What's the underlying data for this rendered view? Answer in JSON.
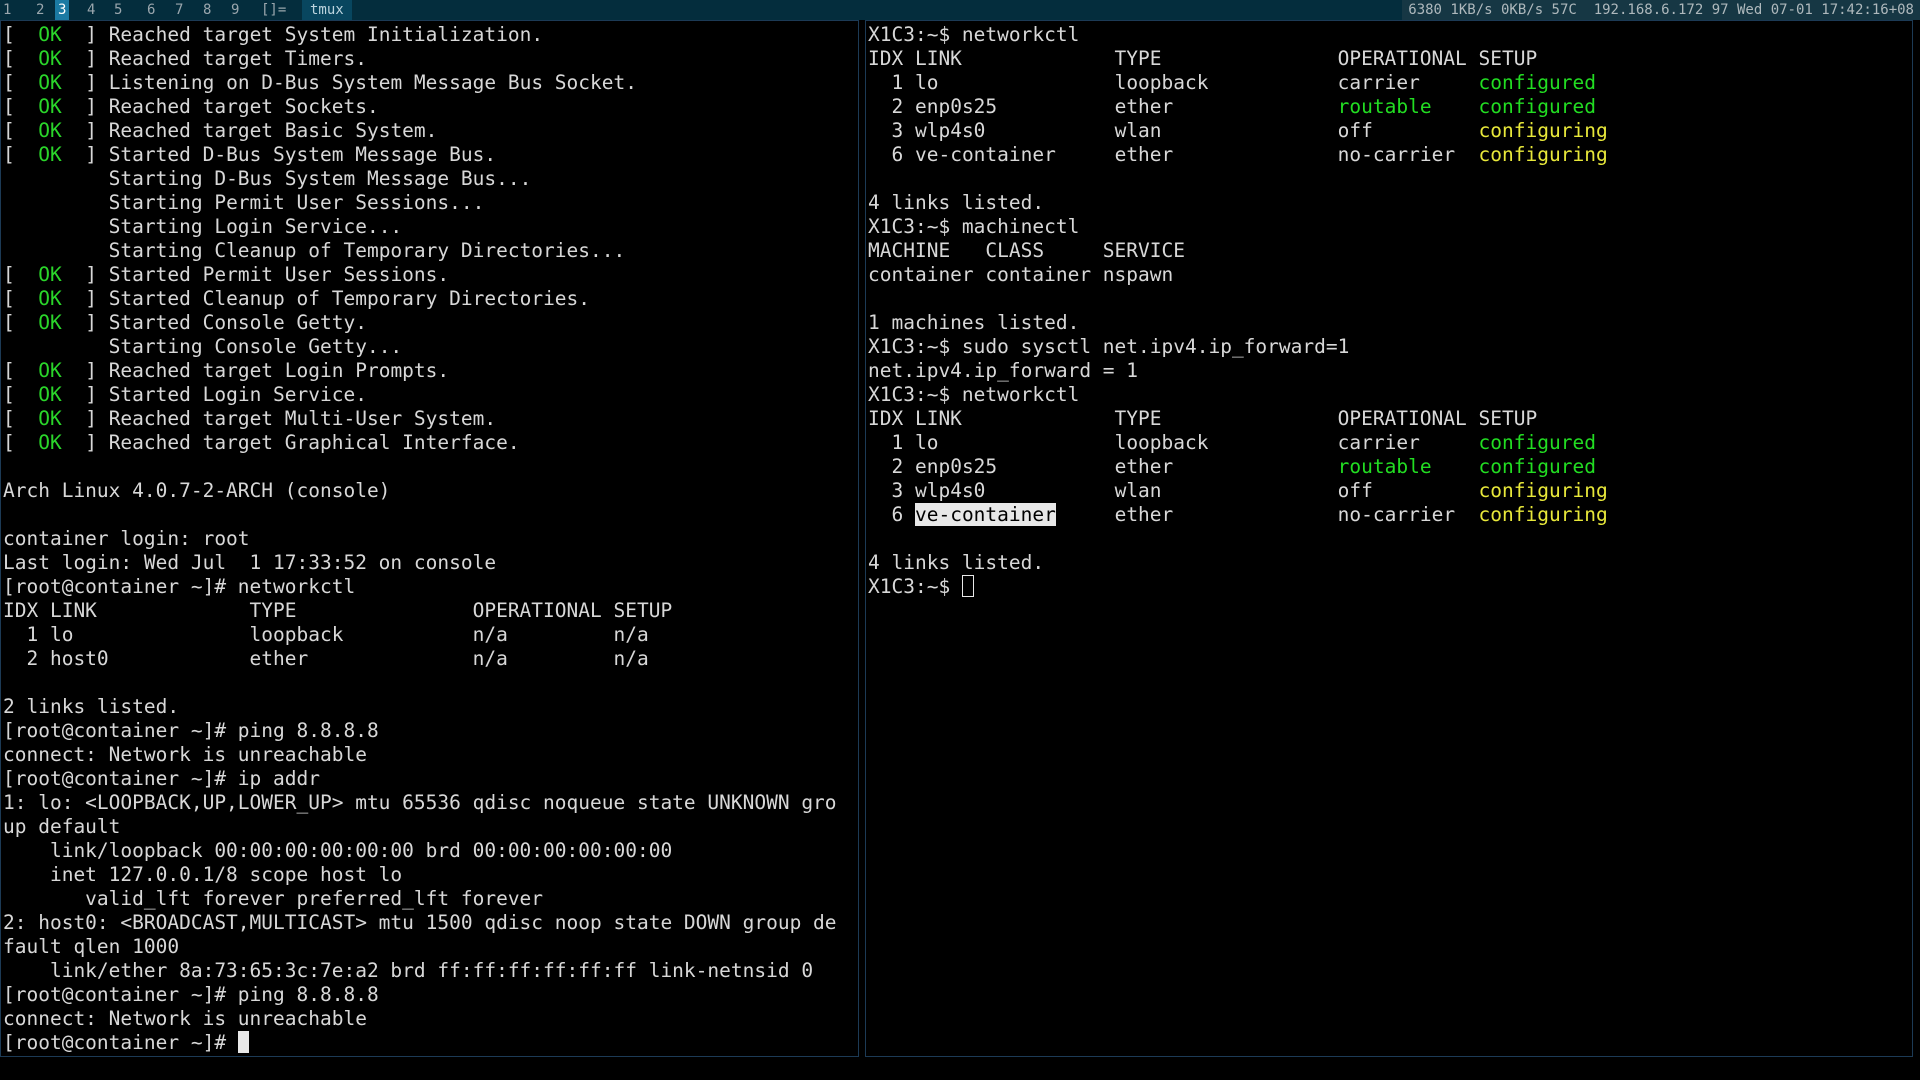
{
  "topbar": {
    "workspaces": [
      {
        "label": "1",
        "active": false
      },
      {
        "label": "2",
        "active": false
      },
      {
        "label": "3",
        "active": true
      },
      {
        "label": "4",
        "active": false
      },
      {
        "label": "5",
        "active": false
      },
      {
        "label": "6",
        "active": false
      },
      {
        "label": "7",
        "active": false
      },
      {
        "label": "8",
        "active": false
      },
      {
        "label": "9",
        "active": false
      }
    ],
    "layout_indicator": "[]=",
    "window_title": "tmux",
    "status": "6380 1KB/s 0KB/s 57C  192.168.6.172 97 Wed 07-01 17:42:16+08"
  },
  "left_pane": {
    "boot": [
      {
        "status": "OK",
        "msg": "Reached target System Initialization."
      },
      {
        "status": "OK",
        "msg": "Reached target Timers."
      },
      {
        "status": "OK",
        "msg": "Listening on D-Bus System Message Bus Socket."
      },
      {
        "status": "OK",
        "msg": "Reached target Sockets."
      },
      {
        "status": "OK",
        "msg": "Reached target Basic System."
      },
      {
        "status": "OK",
        "msg": "Started D-Bus System Message Bus."
      },
      {
        "status": "",
        "msg": "Starting D-Bus System Message Bus..."
      },
      {
        "status": "",
        "msg": "Starting Permit User Sessions..."
      },
      {
        "status": "",
        "msg": "Starting Login Service..."
      },
      {
        "status": "",
        "msg": "Starting Cleanup of Temporary Directories..."
      },
      {
        "status": "OK",
        "msg": "Started Permit User Sessions."
      },
      {
        "status": "OK",
        "msg": "Started Cleanup of Temporary Directories."
      },
      {
        "status": "OK",
        "msg": "Started Console Getty."
      },
      {
        "status": "",
        "msg": "Starting Console Getty..."
      },
      {
        "status": "OK",
        "msg": "Reached target Login Prompts."
      },
      {
        "status": "OK",
        "msg": "Started Login Service."
      },
      {
        "status": "OK",
        "msg": "Reached target Multi-User System."
      },
      {
        "status": "OK",
        "msg": "Reached target Graphical Interface."
      }
    ],
    "lines": [
      "",
      "Arch Linux 4.0.7-2-ARCH (console)",
      "",
      "container login: root",
      "Last login: Wed Jul  1 17:33:52 on console",
      "[root@container ~]# networkctl",
      "IDX LINK             TYPE               OPERATIONAL SETUP",
      "  1 lo               loopback           n/a         n/a",
      "  2 host0            ether              n/a         n/a",
      "",
      "2 links listed.",
      "[root@container ~]# ping 8.8.8.8",
      "connect: Network is unreachable",
      "[root@container ~]# ip addr",
      "1: lo: <LOOPBACK,UP,LOWER_UP> mtu 65536 qdisc noqueue state UNKNOWN gro",
      "up default",
      "    link/loopback 00:00:00:00:00:00 brd 00:00:00:00:00:00",
      "    inet 127.0.0.1/8 scope host lo",
      "       valid_lft forever preferred_lft forever",
      "2: host0: <BROADCAST,MULTICAST> mtu 1500 qdisc noop state DOWN group de",
      "fault qlen 1000",
      "    link/ether 8a:73:65:3c:7e:a2 brd ff:ff:ff:ff:ff:ff link-netnsid 0",
      "[root@container ~]# ping 8.8.8.8",
      "connect: Network is unreachable"
    ],
    "prompt": "[root@container ~]# "
  },
  "right_pane": {
    "prompt": "X1C3:~$ ",
    "cmd1": "networkctl",
    "net_header": "IDX LINK             TYPE               OPERATIONAL SETUP",
    "net_rows": [
      {
        "idx": "  1",
        "link": "lo",
        "type": "loopback",
        "op": "carrier",
        "op_color": "",
        "setup": "configured",
        "setup_color": "green"
      },
      {
        "idx": "  2",
        "link": "enp0s25",
        "type": "ether",
        "op": "routable",
        "op_color": "green",
        "setup": "configured",
        "setup_color": "green"
      },
      {
        "idx": "  3",
        "link": "wlp4s0",
        "type": "wlan",
        "op": "off",
        "op_color": "",
        "setup": "configuring",
        "setup_color": "yellow"
      },
      {
        "idx": "  6",
        "link": "ve-container",
        "type": "ether",
        "op": "no-carrier",
        "op_color": "",
        "setup": "configuring",
        "setup_color": "yellow"
      }
    ],
    "links_listed": "4 links listed.",
    "cmd2": "machinectl",
    "machine_header": "MACHINE   CLASS     SERVICE",
    "machine_row": "container container nspawn",
    "machines_listed": "1 machines listed.",
    "cmd3": "sudo sysctl net.ipv4.ip_forward=1",
    "sysctl_out": "net.ipv4.ip_forward = 1",
    "cmd4": "networkctl"
  }
}
